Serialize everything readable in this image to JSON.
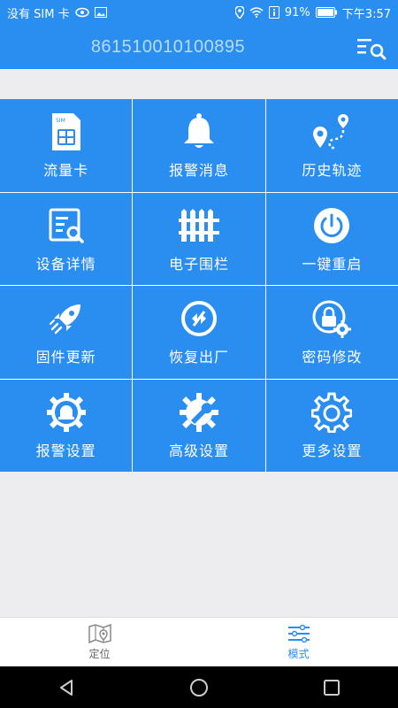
{
  "status_bar": {
    "carrier": "没有 SIM 卡",
    "battery": "91%",
    "time": "下午3:57"
  },
  "app_bar": {
    "title": "861510010100895",
    "list_icon": "list-search-icon"
  },
  "grid": {
    "items": [
      {
        "label": "流量卡",
        "icon": "sim-card-icon"
      },
      {
        "label": "报警消息",
        "icon": "bell-icon"
      },
      {
        "label": "历史轨迹",
        "icon": "route-icon"
      },
      {
        "label": "设备详情",
        "icon": "device-detail-icon"
      },
      {
        "label": "电子围栏",
        "icon": "fence-icon"
      },
      {
        "label": "一键重启",
        "icon": "power-icon"
      },
      {
        "label": "固件更新",
        "icon": "rocket-icon"
      },
      {
        "label": "恢复出厂",
        "icon": "reset-icon"
      },
      {
        "label": "密码修改",
        "icon": "lock-gear-icon"
      },
      {
        "label": "报警设置",
        "icon": "alarm-gear-icon"
      },
      {
        "label": "高级设置",
        "icon": "wrench-gear-icon"
      },
      {
        "label": "更多设置",
        "icon": "gear-icon"
      }
    ]
  },
  "bottom_nav": {
    "items": [
      {
        "label": "定位",
        "icon": "map-icon",
        "active": false
      },
      {
        "label": "模式",
        "icon": "sliders-icon",
        "active": true
      }
    ]
  },
  "colors": {
    "primary": "#2a8ef0",
    "background": "#ededf0",
    "active_tab": "#2a8ef0"
  }
}
